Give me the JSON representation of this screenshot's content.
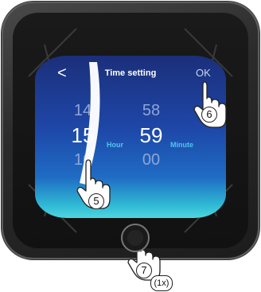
{
  "screen": {
    "back_glyph": "<",
    "title": "Time setting",
    "confirm_label": "OK"
  },
  "picker": {
    "hour": {
      "prev": "14",
      "current": "15",
      "next": "16",
      "unit": "Hour"
    },
    "minute": {
      "prev": "58",
      "current": "59",
      "next": "00",
      "unit": "Minute"
    }
  },
  "callouts": {
    "swipe_step": "5",
    "ok_step": "6",
    "button_step": "7",
    "button_repeat": "(1x)"
  },
  "colors": {
    "accent": "#4fc6ef",
    "screen_top": "#1b2f7a",
    "screen_bottom": "#4fd6e0"
  }
}
